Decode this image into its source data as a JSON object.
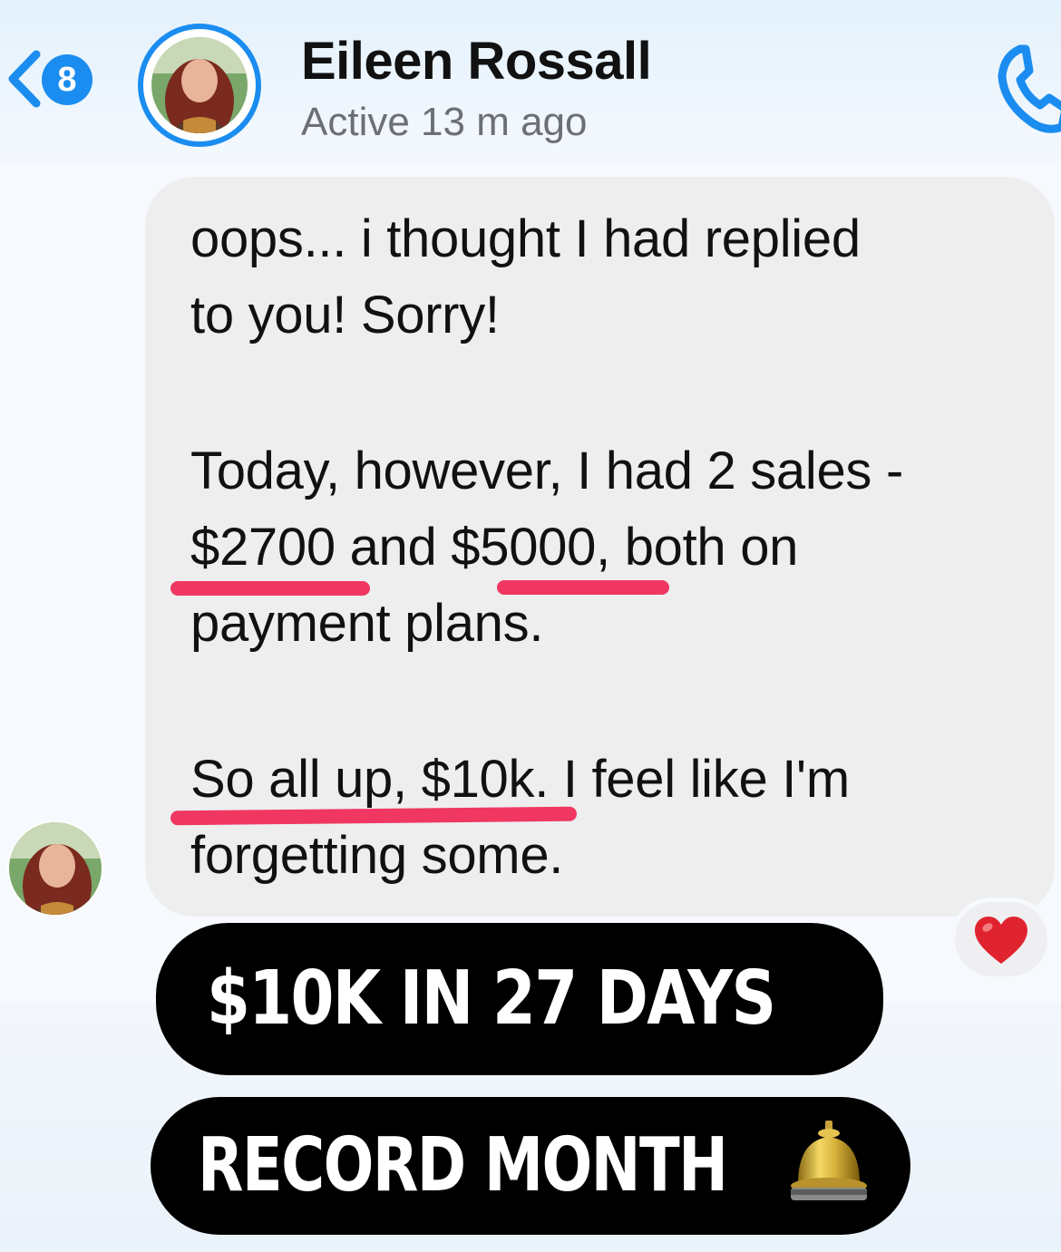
{
  "header": {
    "back_badge_count": "8",
    "contact_name": "Eileen Rossall",
    "active_status": "Active 13 m ago",
    "icons": {
      "back": "chevron-left-icon",
      "call": "phone-icon"
    }
  },
  "message": {
    "lines": [
      "oops... i thought I had replied",
      "to you! Sorry!",
      "Today, however, I had 2 sales -",
      "$2700 and $5000, both on",
      "payment plans.",
      "So all up, $10k. I feel like I'm",
      "forgetting some."
    ],
    "reaction": "heart-icon"
  },
  "overlay": {
    "banner_1": "$10K IN 27 DAYS",
    "banner_2": "RECORD MONTH",
    "banner_2_emoji": "bell-icon"
  },
  "colors": {
    "accent_blue": "#1b8df0",
    "bubble_gray": "#eeeeef",
    "highlight_red": "#ef3762",
    "heart_red": "#e0242f"
  }
}
